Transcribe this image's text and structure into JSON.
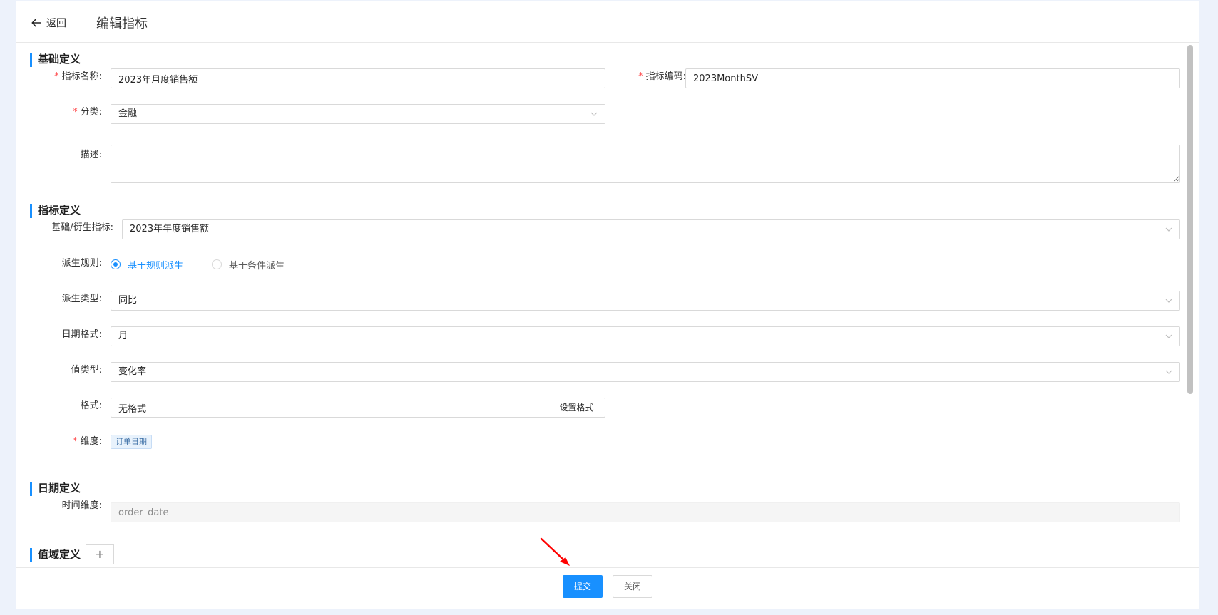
{
  "header": {
    "back_label": "返回",
    "title": "编辑指标"
  },
  "basic": {
    "section_title": "基础定义",
    "name_label": "指标名称:",
    "name_value": "2023年月度销售额",
    "code_label": "指标编码:",
    "code_value": "2023MonthSV",
    "category_label": "分类:",
    "category_value": "金融",
    "desc_label": "描述:",
    "desc_value": ""
  },
  "metric": {
    "section_title": "指标定义",
    "base_label": "基础/衍生指标:",
    "base_value": "2023年年度销售额",
    "rule_label": "派生规则:",
    "rule_options": [
      "基于规则派生",
      "基于条件派生"
    ],
    "rule_selected": "基于规则派生",
    "derive_type_label": "派生类型:",
    "derive_type_value": "同比",
    "date_format_label": "日期格式:",
    "date_format_value": "月",
    "value_type_label": "值类型:",
    "value_type_value": "变化率",
    "format_label": "格式:",
    "format_value": "无格式",
    "format_button": "设置格式",
    "dimension_label": "维度:",
    "dimension_tag": "订单日期"
  },
  "date_def": {
    "section_title": "日期定义",
    "time_dim_label": "时间维度:",
    "time_dim_value": "order_date"
  },
  "range_def": {
    "section_title": "值域定义",
    "add_label": "+"
  },
  "footer": {
    "submit_label": "提交",
    "close_label": "关闭"
  },
  "colors": {
    "accent": "#1890ff",
    "required": "#ff4d4f",
    "annotation_arrow": "#ff0000"
  }
}
